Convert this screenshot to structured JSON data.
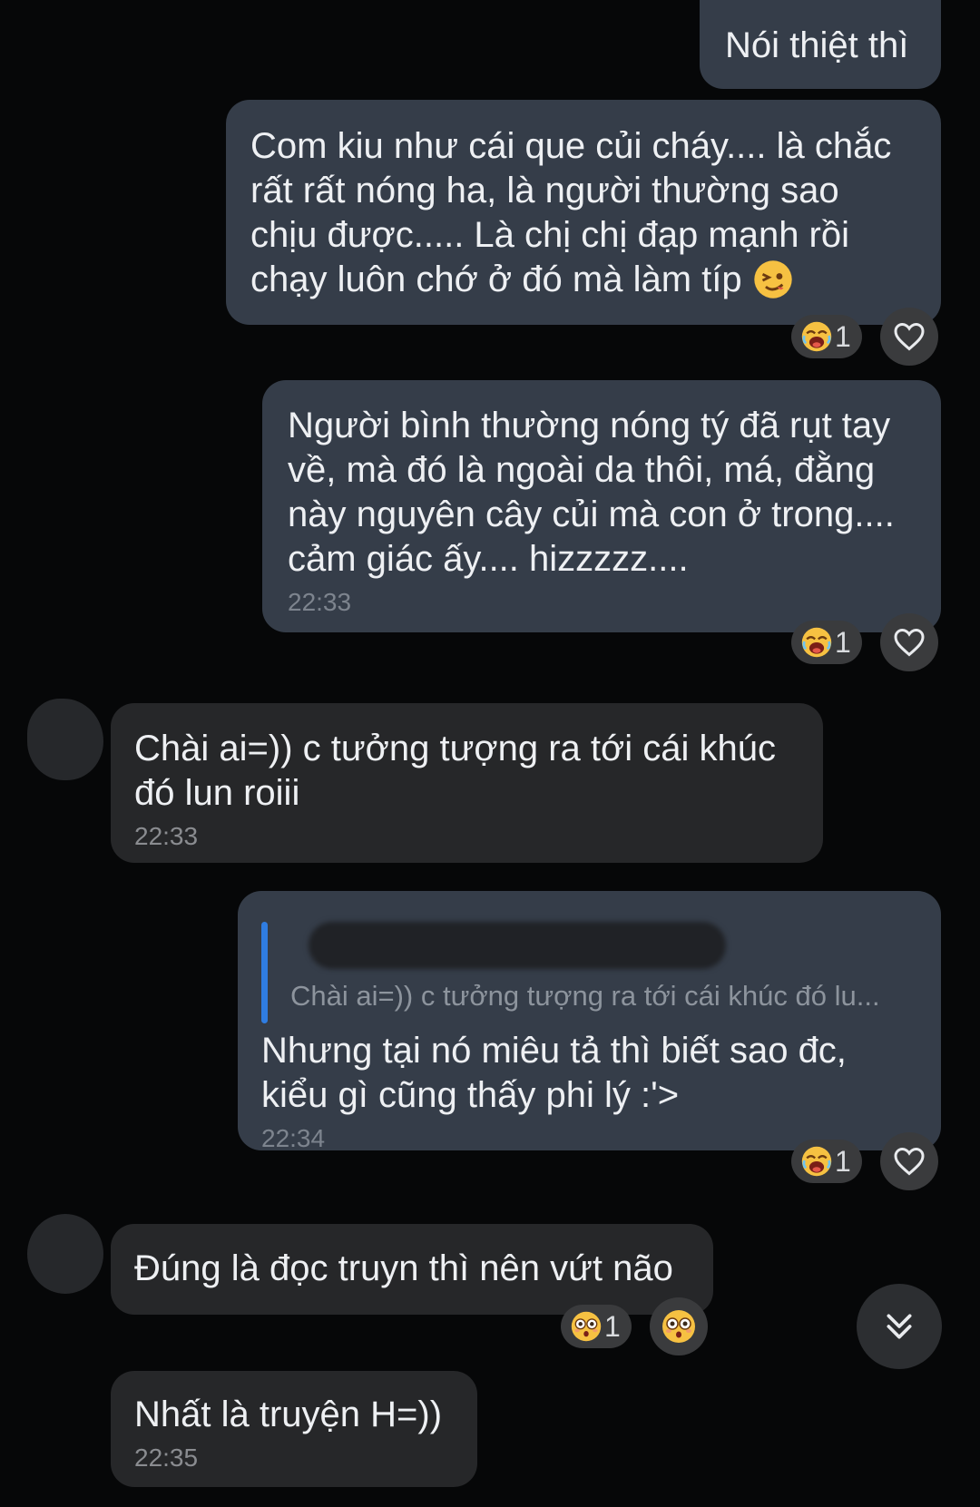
{
  "messages": [
    {
      "text": "Nói thiệt thì"
    },
    {
      "text": "Com kiu như cái que củi cháy.... là chắc rất rất nóng ha, là người thường sao chịu được..... Là chị chị đạp mạnh rồi chạy luôn chớ ở đó mà làm típ",
      "reaction_count": "1"
    },
    {
      "text": "Người bình thường nóng tý đã rụt tay về, mà đó là ngoài da thôi, má, đằng này nguyên cây củi mà con ở trong.... cảm giác ấy.... hizzzzz....",
      "time": "22:33",
      "reaction_count": "1"
    },
    {
      "text": "Chài ai=)) c tưởng tượng ra tới cái khúc đó lun roiii",
      "time": "22:33"
    },
    {
      "quote": "Chài ai=)) c tưởng tượng ra tới cái khúc đó lu...",
      "text": "Nhưng tại nó miêu tả thì biết sao đc, kiểu gì cũng thấy phi lý :'>",
      "time": "22:34",
      "reaction_count": "1"
    },
    {
      "text": "Đúng là đọc truyn thì nên vứt não",
      "reaction_count": "1"
    },
    {
      "text": "Nhất là truyện H=))",
      "time": "22:35"
    }
  ],
  "icons": {
    "laugh": "laughing-face-icon",
    "wink": "winking-face-icon",
    "flushed": "flushed-face-icon",
    "heart": "heart-outline-icon",
    "scroll": "double-chevron-down-icon"
  },
  "colors": {
    "background": "#060708",
    "outgoing_bubble": "#353d49",
    "incoming_bubble": "#262729",
    "quote_bar": "#2f7de2"
  }
}
